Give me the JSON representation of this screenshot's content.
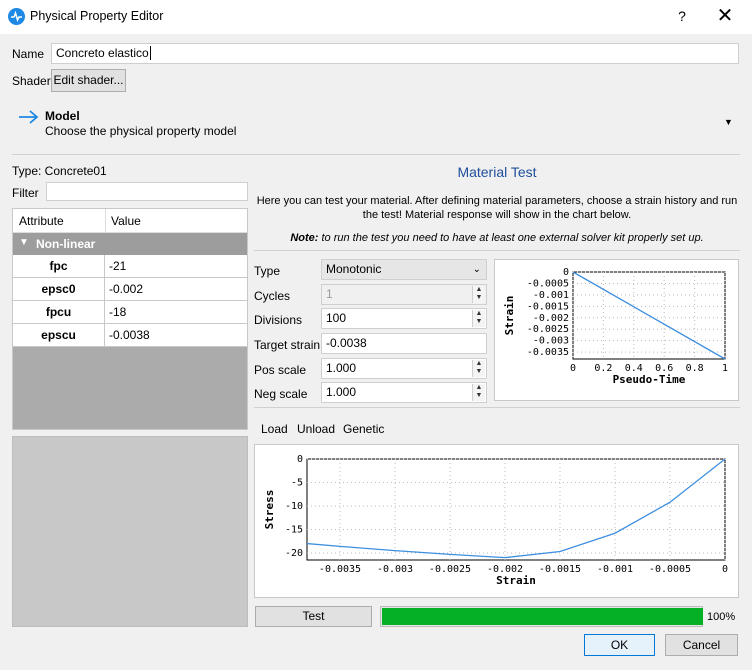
{
  "window": {
    "title": "Physical Property Editor",
    "help": "?",
    "close": "✕"
  },
  "name": {
    "label": "Name",
    "value": "Concreto elastico"
  },
  "shader": {
    "label": "Shader",
    "button": "Edit shader..."
  },
  "model": {
    "title": "Model",
    "subtitle": "Choose the physical property model"
  },
  "type_line": "Type:  Concrete01",
  "filter": {
    "label": "Filter",
    "value": ""
  },
  "table": {
    "headers": [
      "Attribute",
      "Value"
    ],
    "group": "Non-linear",
    "rows": [
      {
        "name": "fpc",
        "value": "-21"
      },
      {
        "name": "epsc0",
        "value": "-0.002"
      },
      {
        "name": "fpcu",
        "value": "-18"
      },
      {
        "name": "epscu",
        "value": "-0.0038"
      }
    ]
  },
  "test": {
    "title": "Material Test",
    "desc": "Here you can test your material. After defining material parameters, choose a strain history and run the test! Material response will show in the chart below.",
    "note_bold": "Note:",
    "note_rest": " to run the test you need to have at least one external solver kit properly set up.",
    "type_label": "Type",
    "type_value": "Monotonic",
    "cycles_label": "Cycles",
    "cycles_value": "1",
    "divisions_label": "Divisions",
    "divisions_value": "100",
    "target_label": "Target strain",
    "target_value": "-0.0038",
    "pos_label": "Pos scale",
    "pos_value": "1.000",
    "neg_label": "Neg scale",
    "neg_value": "1.000",
    "tabs": [
      "Load",
      "Unload",
      "Genetic"
    ],
    "test_button": "Test",
    "progress_label": "100%",
    "progress": 1.0
  },
  "buttons": {
    "ok": "OK",
    "cancel": "Cancel"
  },
  "colors": {
    "accent": "#1e88e5",
    "progress": "#06b025",
    "curve": "#3d8fe0"
  },
  "chart_data": [
    {
      "type": "line",
      "xlabel": "Pseudo-Time",
      "ylabel": "Strain",
      "xlim": [
        0,
        1
      ],
      "ylim": [
        -0.0038,
        0
      ],
      "xticks": [
        "0",
        "0.2",
        "0.4",
        "0.6",
        "0.8",
        "1"
      ],
      "yticks": [
        "0",
        "-0.0005",
        "-0.001",
        "-0.0015",
        "-0.002",
        "-0.0025",
        "-0.003",
        "-0.0035"
      ],
      "x": [
        0,
        1
      ],
      "y": [
        0,
        -0.0038
      ]
    },
    {
      "type": "line",
      "xlabel": "Strain",
      "ylabel": "Stress",
      "xlim": [
        -0.0038,
        0
      ],
      "ylim": [
        -21.5,
        0
      ],
      "xticks": [
        "-0.0035",
        "-0.003",
        "-0.0025",
        "-0.002",
        "-0.0015",
        "-0.001",
        "-0.0005",
        "0"
      ],
      "yticks": [
        "0",
        "-5",
        "-10",
        "-15",
        "-20"
      ],
      "x": [
        0,
        -0.0005,
        -0.001,
        -0.0015,
        -0.002,
        -0.0025,
        -0.003,
        -0.0035,
        -0.0038
      ],
      "y": [
        0,
        -9.2,
        -15.8,
        -19.7,
        -21,
        -20.3,
        -19.5,
        -18.6,
        -18
      ]
    }
  ]
}
